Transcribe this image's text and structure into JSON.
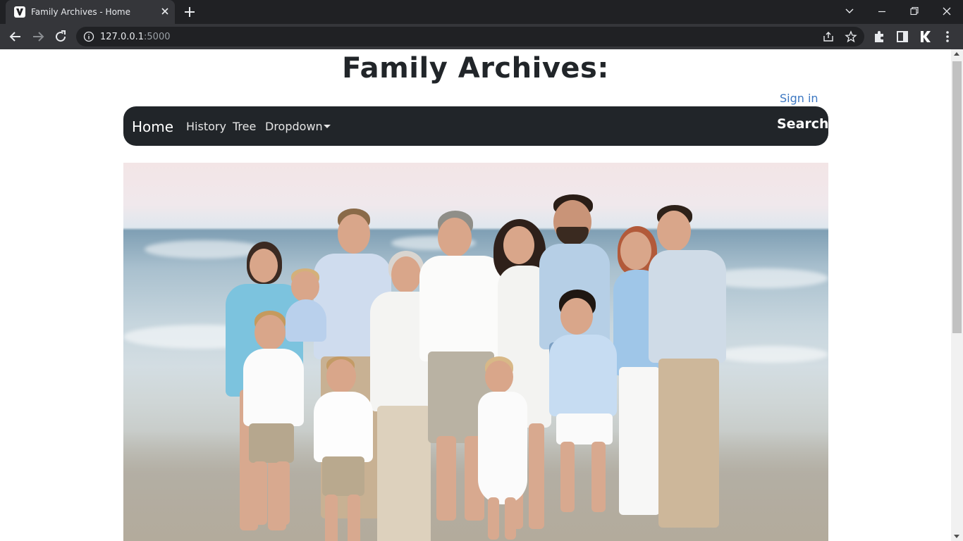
{
  "browser": {
    "tab_title": "Family Archives - Home",
    "url_host": "127.0.0.1",
    "url_port": ":5000",
    "icons": {
      "favicon": "site-favicon-icon",
      "tab_close": "close-icon",
      "new_tab": "plus-icon",
      "back": "arrow-left-icon",
      "forward": "arrow-right-icon",
      "reload": "reload-icon",
      "site_info": "info-icon",
      "share": "share-icon",
      "bookmark": "star-icon",
      "extensions": "puzzle-icon",
      "side_panel": "side-panel-icon",
      "profile": "profile-k-icon",
      "menu": "kebab-menu-icon"
    }
  },
  "page": {
    "title": "Family Archives:",
    "sign_in": "Sign in",
    "nav": {
      "brand": "Home",
      "links": [
        "History",
        "Tree",
        "Dropdown"
      ],
      "search": "Search"
    },
    "hero_image_alt": "family-beach-photo",
    "colors": {
      "navbar_bg": "#212529",
      "link": "#3d78c2",
      "title_text": "#212529"
    }
  }
}
